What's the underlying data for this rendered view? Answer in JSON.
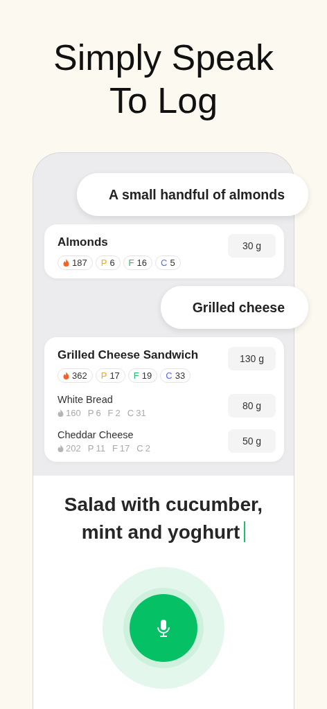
{
  "headline": [
    "Simply Speak",
    "To Log"
  ],
  "log": [
    {
      "kind": "speech",
      "text": "A small handful of almonds"
    },
    {
      "kind": "meal",
      "name": "Almonds",
      "weight": "30 g",
      "macros": [
        {
          "kind": "calories",
          "value": "187"
        },
        {
          "kind": "letter",
          "label": "P",
          "value": "6",
          "color": "#f5a623"
        },
        {
          "kind": "letter",
          "label": "F",
          "value": "16",
          "color": "#1fbf6a"
        },
        {
          "kind": "letter",
          "label": "C",
          "value": "5",
          "color": "#5b6cf5"
        }
      ]
    },
    {
      "kind": "speech",
      "text": "Grilled cheese"
    },
    {
      "kind": "meal",
      "name": "Grilled Cheese Sandwich",
      "weight": "130 g",
      "macros": [
        {
          "kind": "calories",
          "value": "362"
        },
        {
          "kind": "letter",
          "label": "P",
          "value": "17",
          "color": "#f5a623"
        },
        {
          "kind": "letter",
          "label": "F",
          "value": "19",
          "color": "#1fbf6a"
        },
        {
          "kind": "letter",
          "label": "C",
          "value": "33",
          "color": "#5b6cf5"
        }
      ],
      "ingredients": [
        {
          "name": "White Bread",
          "weight": "80 g",
          "macros": [
            {
              "kind": "calories",
              "value": "160"
            },
            {
              "kind": "letter",
              "label": "P",
              "value": "6"
            },
            {
              "kind": "letter",
              "label": "F",
              "value": "2"
            },
            {
              "kind": "letter",
              "label": "C",
              "value": "31"
            }
          ]
        },
        {
          "name": "Cheddar Cheese",
          "weight": "50 g",
          "macros": [
            {
              "kind": "calories",
              "value": "202"
            },
            {
              "kind": "letter",
              "label": "P",
              "value": "11"
            },
            {
              "kind": "letter",
              "label": "F",
              "value": "17"
            },
            {
              "kind": "letter",
              "label": "C",
              "value": "2"
            }
          ]
        }
      ]
    }
  ],
  "transcript": "Salad with cucumber, mint and yoghurt"
}
